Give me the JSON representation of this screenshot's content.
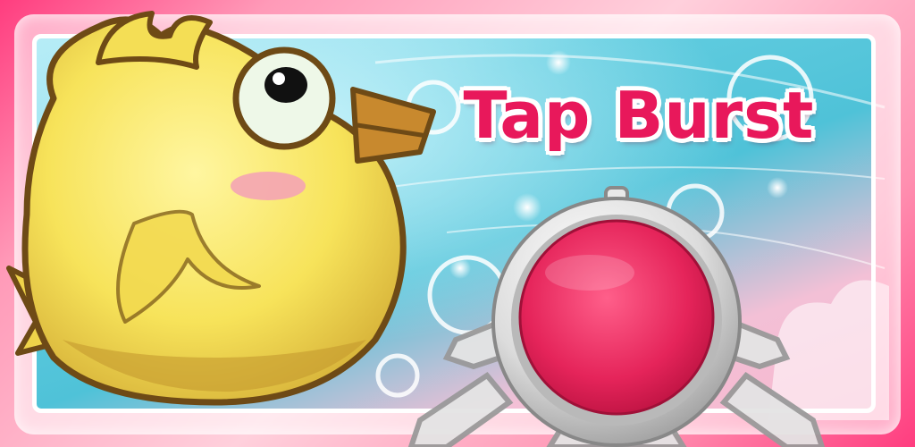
{
  "game": {
    "title": "Tap Burst"
  },
  "colors": {
    "title": "#e8185b",
    "button_red": "#e5245a",
    "bird_yellow": "#f7e35a",
    "panel_blue": "#4fc2d8",
    "frame_pink": "#ff3d7f"
  },
  "elements": {
    "mascot": "yellow-bird-character",
    "button": "big-red-push-button"
  }
}
